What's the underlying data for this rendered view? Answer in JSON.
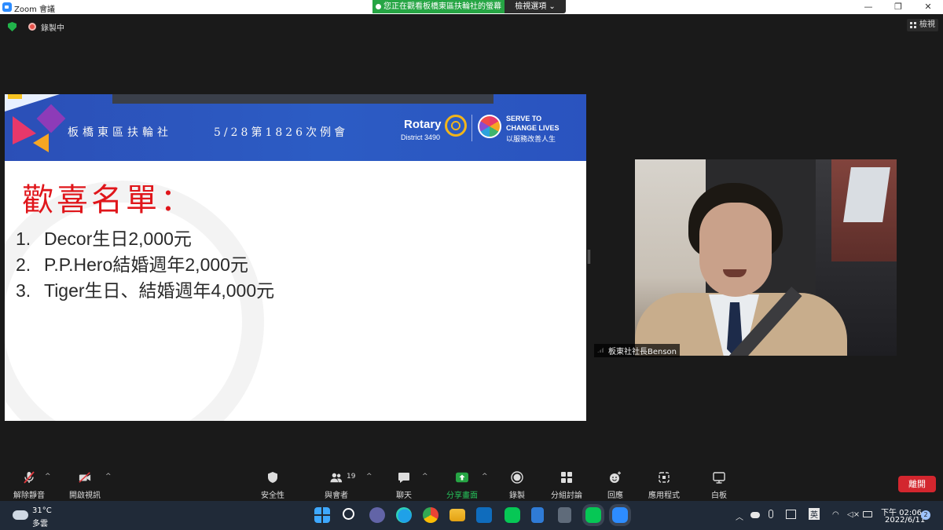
{
  "window": {
    "title": "Zoom 會議",
    "share_banner": "您正在觀看板橋東區扶輪社的螢幕",
    "view_options": "檢視選項 ⌄",
    "minimize": "—",
    "restore": "❐",
    "close": "✕"
  },
  "meeting": {
    "recording_label": "錄製中",
    "view_label": "檢視"
  },
  "slide": {
    "club": "板橋東區扶輪社",
    "meeting": "5/28第1826次例會",
    "rotary": "Rotary",
    "district": "District 3490",
    "serve_line1": "SERVE TO",
    "serve_line2": "CHANGE LIVES",
    "serve_line3": "以服務改善人生",
    "heading": "歡喜名單：",
    "items": [
      {
        "num": "1.",
        "text": "Decor生日2,000元"
      },
      {
        "num": "2.",
        "text": "P.P.Hero結婚週年2,000元"
      },
      {
        "num": "3.",
        "text": "Tiger生日、結婚週年4,000元"
      }
    ]
  },
  "video": {
    "participant_name": "板東社社長Benson"
  },
  "toolbar": {
    "unmute": "解除靜音",
    "start_video": "開啟視訊",
    "security": "安全性",
    "participants": "與會者",
    "participants_count": "19",
    "chat": "聊天",
    "share_screen": "分享畫面",
    "record": "錄製",
    "breakout": "分組討論",
    "reactions": "回應",
    "apps": "應用程式",
    "whiteboard": "白板",
    "leave": "離開",
    "caret": "^"
  },
  "taskbar": {
    "temperature": "31°C",
    "weather": "多雲",
    "time": "下午 02:06",
    "date": "2022/6/11",
    "notifications": "2",
    "ime": "英"
  },
  "colors": {
    "share_green": "#26a544",
    "leave_red": "#d3262e",
    "heading_red": "#e0161b",
    "slide_header_blue": "#2c5cc4"
  }
}
